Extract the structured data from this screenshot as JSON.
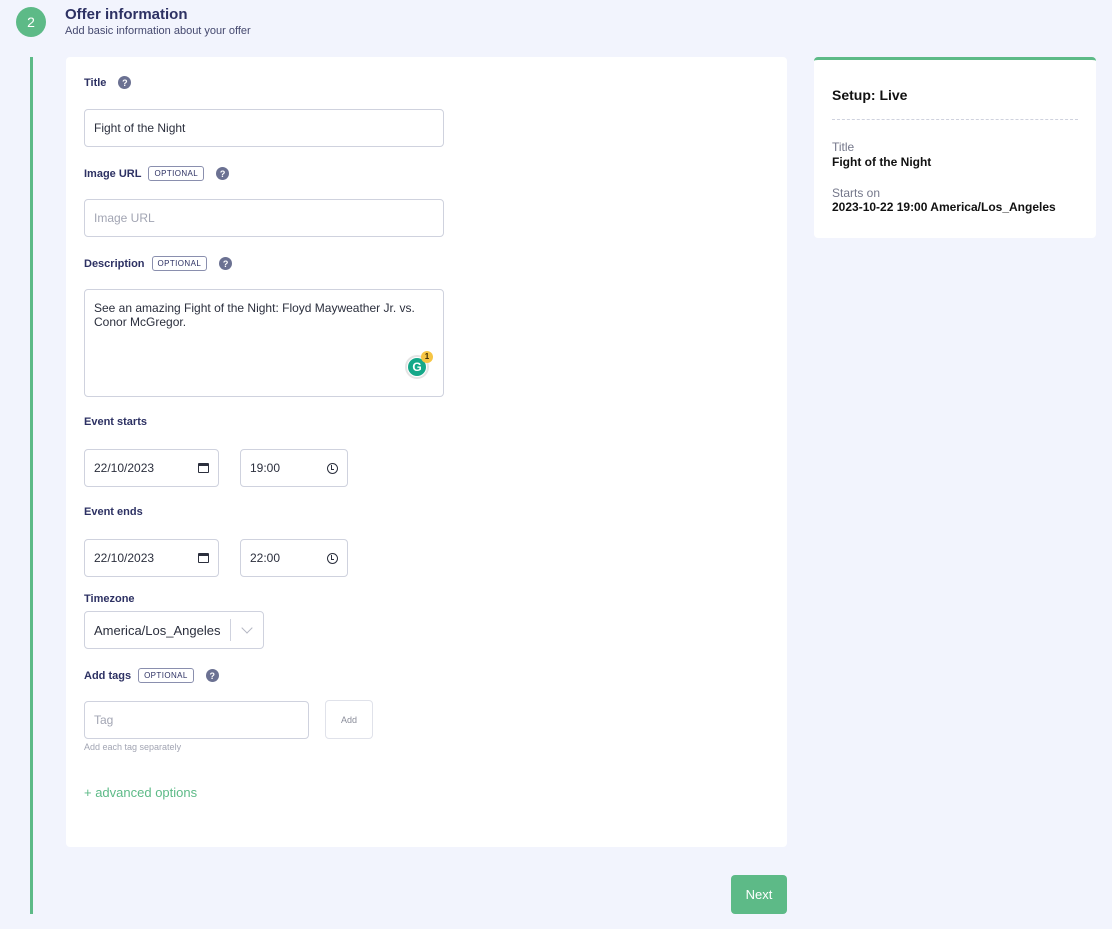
{
  "step": {
    "number": "2",
    "title": "Offer information",
    "subtitle": "Add basic information about your offer"
  },
  "form": {
    "help_symbol": "?",
    "optional_badge": "OPTIONAL",
    "title": {
      "label": "Title",
      "value": "Fight of the Night"
    },
    "image_url": {
      "label": "Image URL",
      "placeholder": "Image URL"
    },
    "description": {
      "label": "Description",
      "value": "See an amazing Fight of the Night: Floyd Mayweather Jr. vs. Conor McGregor."
    },
    "grammarly": {
      "letter": "G",
      "count": "1"
    },
    "event_starts": {
      "label": "Event starts",
      "date": "22/10/2023",
      "time": "19:00"
    },
    "event_ends": {
      "label": "Event ends",
      "date": "22/10/2023",
      "time": "22:00"
    },
    "timezone": {
      "label": "Timezone",
      "value": "America/Los_Angeles"
    },
    "tags": {
      "label": "Add tags",
      "placeholder": "Tag",
      "add_label": "Add",
      "hint": "Add each tag separately"
    },
    "advanced_link": "+ advanced options"
  },
  "next_label": "Next",
  "summary": {
    "title": "Setup: Live",
    "title_key": "Title",
    "title_value": "Fight of the Night",
    "starts_key": "Starts on",
    "starts_value": "2023-10-22 19:00 America/Los_Angeles"
  },
  "colors": {
    "accent": "#5dba87",
    "background": "#f2f4fd",
    "text": "#2d3163"
  },
  "icons": [
    "help-icon",
    "calendar-icon",
    "clock-icon",
    "chevron-down-icon",
    "grammarly-icon"
  ]
}
